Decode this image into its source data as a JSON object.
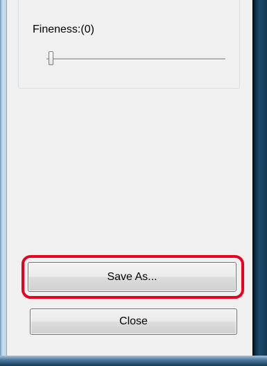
{
  "fineness": {
    "label": "Fineness:(0)",
    "slider_value": 0
  },
  "buttons": {
    "save_as": "Save As...",
    "close": "Close"
  },
  "colors": {
    "highlight": "#e8001c",
    "frame": "#1d4a6e",
    "client_bg": "#f0f0f0"
  }
}
